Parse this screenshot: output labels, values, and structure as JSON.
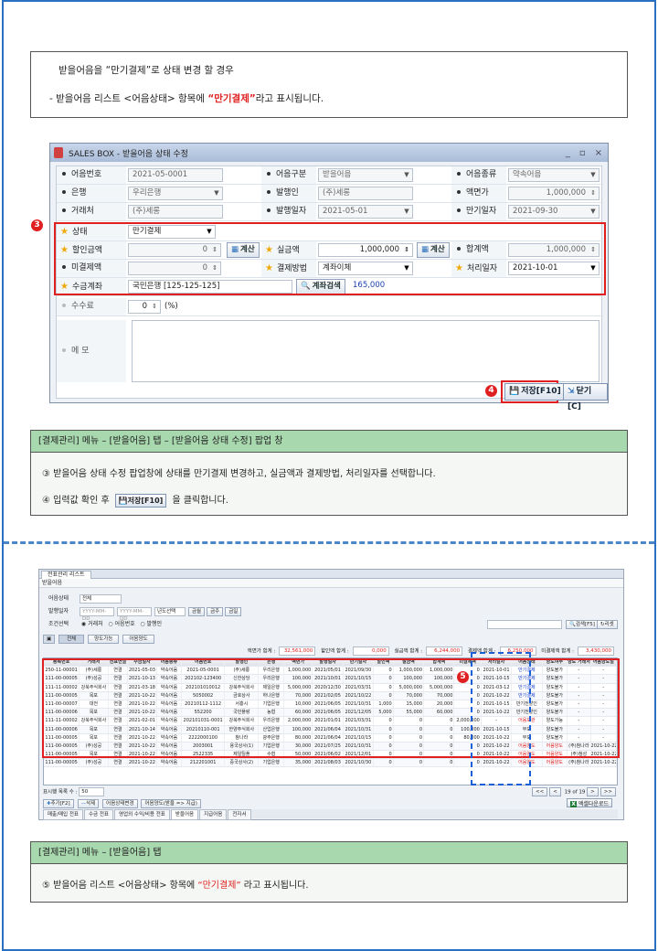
{
  "note": {
    "line1": "받을어음을 “만기결제”로 상태 변경 할 경우",
    "line2_prefix": "- 받을어음 리스트 <어음상태> 항목에 ",
    "line2_highlight": "“만기결제”",
    "line2_suffix": "라고 표시됩니다."
  },
  "popup": {
    "title": "SALES BOX - 받을어음 상태 수정",
    "ctrl_min": "_",
    "ctrl_max": "▫",
    "ctrl_close": "×",
    "rows": {
      "r1": {
        "l1": "어음번호",
        "v1": "2021-05-0001",
        "l2": "어음구분",
        "v2": "받을어음",
        "l3": "어음종류",
        "v3": "약속어음"
      },
      "r2": {
        "l1": "은행",
        "v1": "우리은행",
        "l2": "발행인",
        "v2": "(주)세롱",
        "l3": "액면가",
        "v3": "1,000,000"
      },
      "r3": {
        "l1": "거래처",
        "v1": "(주)세롱",
        "l2": "발행일자",
        "v2": "2021-05-01",
        "l3": "만기일자",
        "v3": "2021-09-30"
      },
      "r4": {
        "l1": "상태",
        "v1": "만기결제"
      },
      "r5": {
        "l1": "할인금액",
        "v1": "0",
        "calc1": "계산",
        "l2": "실금액",
        "v2": "1,000,000",
        "calc2": "계산",
        "l3": "합계액",
        "v3": "1,000,000"
      },
      "r6": {
        "l1": "미결제액",
        "v1": "0",
        "l2": "결제방법",
        "v2": "계좌이체",
        "l3": "처리일자",
        "v3": "2021-10-01"
      },
      "r7": {
        "l1": "수금계좌",
        "v1": "국민은행 [125-125-125]",
        "search": "계좌검색",
        "amount": "165,000"
      },
      "r8": {
        "l1": "수수료",
        "v1": "0",
        "unit": "(%)"
      },
      "r9": {
        "l1": "메 모"
      }
    },
    "badge3": "3",
    "badge4": "4",
    "save_label": "저장[F10]",
    "close_label": "닫기[C]"
  },
  "exp1": {
    "header": "[결제관리] 메뉴 – [받을어음] 탭 – [받을어음 상태 수정] 팝업 창",
    "line1": "③  받을어음 상태 수정 팝업창에 상태를 만기결제 변경하고, 실금액과 결제방법, 처리일자를 선택합니다.",
    "line2_prefix": "④  입력값 확인 후",
    "line2_btn": "저장[F10]",
    "line2_suffix": "을  클릭합니다."
  },
  "list": {
    "tab": "전표관리 리스트",
    "sub": "받을어음",
    "f1_label": "어음상태",
    "f1_value": "전체",
    "f2_label": "발행일자",
    "f2_from": "YYYY-MM-DD",
    "f2_to": "YYYY-MM-DD",
    "f2_sel": "년도선택",
    "btn_prev": "금월",
    "btn_mid": "금주",
    "btn_next": "금일",
    "f3_label": "조건선택",
    "radio1": "거래처",
    "radio2": "어음번호",
    "radio3": "발행인",
    "search_btn": "검색[F5]",
    "reset_btn": "리셋",
    "tabs": [
      "전체",
      "양도가능",
      "어음양도"
    ],
    "sums": [
      {
        "label": "액면가 합계 :",
        "value": "32,561,000"
      },
      {
        "label": "할인액 합계 :",
        "value": "0,000"
      },
      {
        "label": "실금액 합계 :",
        "value": "6,244,000"
      },
      {
        "label": "결제액 합계 :",
        "value": "6,250,000"
      },
      {
        "label": "미결제액 합계 :",
        "value": "3,430,000"
      }
    ],
    "headers": [
      "등록번호",
      "거래처",
      "전표연결",
      "수금일자",
      "어음종류",
      "어음번호",
      "발행인",
      "은행",
      "액면가",
      "발행일자",
      "만기일자",
      "할인액",
      "실금액",
      "합계액",
      "미결제액",
      "처리일자",
      "어음상태",
      "양도여부",
      "양도 거래처",
      "어음양도일"
    ],
    "rows": [
      [
        "250-11-00001",
        "(주)세롱",
        "연결",
        "2021-05-03",
        "약속어음",
        "2021-05-0001",
        "(주)세롱",
        "우리은행",
        "1,000,000",
        "2021/05/01",
        "2021/09/30",
        "0",
        "1,000,000",
        "1,000,000",
        "0",
        "2021-10-01",
        "만기결제",
        "양도불가",
        "-",
        "-"
      ],
      [
        "111-00-00005",
        "(주)성공",
        "연결",
        "2021-10-13",
        "약속어음",
        "202102-123400",
        "신한상당",
        "우리은행",
        "100,000",
        "2021/10/01",
        "2021/10/15",
        "0",
        "100,000",
        "100,000",
        "0",
        "2021-10-15",
        "만기결제",
        "양도불가",
        "-",
        "-"
      ],
      [
        "111-11-00002",
        "강북주식회사",
        "연결",
        "2021-03-18",
        "약속어음",
        "202101010012",
        "강북주식회사",
        "제일은행",
        "5,000,000",
        "2020/12/30",
        "2021/03/31",
        "0",
        "5,000,000",
        "5,000,000",
        "0",
        "2021-03-12",
        "만기결제",
        "양도불가",
        "-",
        "-"
      ],
      [
        "111-00-00005",
        "목포",
        "연결",
        "2021-10-22",
        "약속어음",
        "5050002",
        "금호상사",
        "하나은행",
        "70,000",
        "2021/02/05",
        "2021/10/22",
        "0",
        "70,000",
        "70,000",
        "0",
        "2021-10-22",
        "만기결제",
        "양도불가",
        "-",
        "-"
      ],
      [
        "111-00-00007",
        "대전",
        "연결",
        "2021-10-22",
        "약속어음",
        "20210112-1112",
        "서흥시",
        "기업은행",
        "10,000",
        "2021/06/05",
        "2021/10/31",
        "1,000",
        "15,000",
        "20,000",
        "0",
        "2021-10-15",
        "만기전할인",
        "양도불가",
        "-",
        "-"
      ],
      [
        "111-00-00006",
        "목포",
        "연결",
        "2021-10-22",
        "약속어음",
        "552200",
        "국민플랑",
        "농협",
        "60,000",
        "2021/06/05",
        "2021/12/05",
        "5,000",
        "55,000",
        "60,000",
        "0",
        "2021-10-22",
        "만기전할인",
        "양도불가",
        "-",
        "-"
      ],
      [
        "111-11-00002",
        "강북주식회사",
        "연결",
        "2021-02-01",
        "약속어음",
        "202101031-0001",
        "강북주식회사",
        "우리은행",
        "2,000,000",
        "2021/01/01",
        "2021/03/31",
        "0",
        "0",
        "0",
        "2,000,000",
        "-",
        "어음보관",
        "양도가능",
        "-",
        "-"
      ],
      [
        "111-00-00006",
        "목포",
        "연결",
        "2021-10-14",
        "약속어음",
        "20210110-001",
        "한양주식회사",
        "산업은행",
        "100,000",
        "2021/06/04",
        "2021/10/31",
        "0",
        "0",
        "0",
        "100,000",
        "2021-10-15",
        "부도",
        "양도불가",
        "-",
        "-"
      ],
      [
        "111-00-00005",
        "목포",
        "연결",
        "2021-10-22",
        "약속어음",
        "2222000100",
        "참나라",
        "광주은행",
        "80,000",
        "2021/06/04",
        "2021/10/15",
        "0",
        "0",
        "0",
        "80,000",
        "2021-10-22",
        "부도",
        "양도불가",
        "-",
        "-"
      ],
      [
        "111-00-00005",
        "(주)성공",
        "연결",
        "2021-10-22",
        "약속어음",
        "2003001",
        "용국상사(1)",
        "기업은행",
        "30,000",
        "2021/07/25",
        "2021/10/31",
        "0",
        "0",
        "0",
        "0",
        "2021-10-22",
        "어음양도",
        "어음양도",
        "(주)참나라",
        "2021-10-22"
      ],
      [
        "111-00-00005",
        "목포",
        "연결",
        "2021-10-22",
        "약속어음",
        "2522335",
        "제일틸플",
        "수협",
        "50,000",
        "2021/06/02",
        "2021/12/01",
        "0",
        "0",
        "0",
        "0",
        "2021-10-22",
        "어음양도",
        "어음양도",
        "(주)참성",
        "2021-10-22"
      ],
      [
        "111-00-00005",
        "(주)성공",
        "연결",
        "2021-10-22",
        "약속어음",
        "212201001",
        "중국상사(2)",
        "기업은행",
        "35,000",
        "2021/08/03",
        "2021/10/30",
        "0",
        "0",
        "0",
        "0",
        "2021-10-22",
        "어음양도",
        "어음양도",
        "(주)참나라",
        "2021-10-22"
      ]
    ],
    "page_label": "표시행 목록 수 :",
    "page_size": "50",
    "page_info": "19 of 19",
    "btn_add": "추가[F2]",
    "btn_del": "삭제",
    "btn_state": "어음상태변경",
    "btn_transfer": "어음양도(받을 => 지급)",
    "excel_btn": "엑셀다운로드",
    "bottom_tabs": [
      "매출/매입 전표",
      "수금 전표",
      "영업외 수익/비용 전표",
      "받을어음",
      "지급어음",
      "전자서"
    ],
    "badge5": "5"
  },
  "exp2": {
    "header": "[결제관리] 메뉴 – [받을어음] 탭",
    "line1_prefix": "⑤  받을어음 리스트 <어음상태> 항목에 ",
    "line1_highlight": "“만기결제”",
    "line1_suffix": " 라고 표시됩니다."
  }
}
